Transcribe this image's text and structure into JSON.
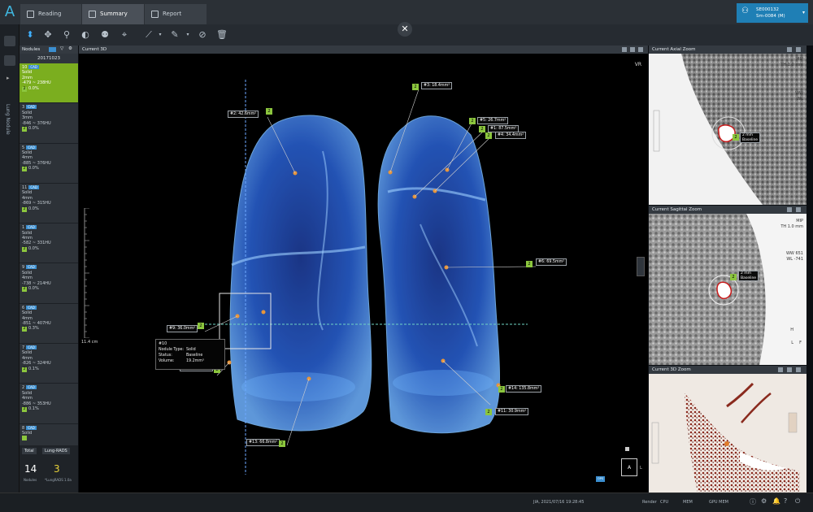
{
  "topbar": {
    "logo": "A",
    "tabs": [
      {
        "label": "Reading"
      },
      {
        "label": "Summary"
      },
      {
        "label": "Report"
      }
    ],
    "patient": {
      "line1": "SE000132",
      "line2": "Sm-0084 (M)",
      "icon": "person-icon",
      "caret": "▾"
    }
  },
  "rail": {
    "label": "Lung Nodule"
  },
  "nodule_panel": {
    "header": "Nodules",
    "cad_tag": "CAD",
    "date": "20171023",
    "items": [
      {
        "num": "10",
        "cad": "CAD",
        "type": "Solid",
        "size": "2mm",
        "hu": "-479 ~ 238HU",
        "pct": "0.0%",
        "badge": "2"
      },
      {
        "num": "3",
        "cad": "CAD",
        "type": "Solid",
        "size": "3mm",
        "hu": "-846 ~ 376HU",
        "pct": "0.0%",
        "badge": "2"
      },
      {
        "num": "5",
        "cad": "CAD",
        "type": "Solid",
        "size": "4mm",
        "hu": "-885 ~ 376HU",
        "pct": "0.0%",
        "badge": "2"
      },
      {
        "num": "11",
        "cad": "CAD",
        "type": "Solid",
        "size": "4mm",
        "hu": "-869 ~ 315HU",
        "pct": "0.0%",
        "badge": "2"
      },
      {
        "num": "1",
        "cad": "CAD",
        "type": "Solid",
        "size": "4mm",
        "hu": "-582 ~ 331HU",
        "pct": "0.0%",
        "badge": "2"
      },
      {
        "num": "9",
        "cad": "CAD",
        "type": "Solid",
        "size": "4mm",
        "hu": "-738 ~ 214HU",
        "pct": "0.0%",
        "badge": "2"
      },
      {
        "num": "6",
        "cad": "CAD",
        "type": "Solid",
        "size": "4mm",
        "hu": "-851 ~ 407HU",
        "pct": "0.3%",
        "badge": "2"
      },
      {
        "num": "7",
        "cad": "CAD",
        "type": "Solid",
        "size": "4mm",
        "hu": "-826 ~ 324HU",
        "pct": "0.1%",
        "badge": "2"
      },
      {
        "num": "2",
        "cad": "CAD",
        "type": "Solid",
        "size": "4mm",
        "hu": "-886 ~ 353HU",
        "pct": "0.1%",
        "badge": "2"
      },
      {
        "num": "8",
        "cad": "CAD",
        "type": "Solid",
        "size": "",
        "hu": "",
        "pct": "",
        "badge": ""
      }
    ],
    "totals": {
      "total_label": "Total",
      "lungrads_label": "Lung-RADS",
      "total_value": "14",
      "total_sub": "Nodules",
      "lungrads_value": "3",
      "lungrads_sub": "*LungRADS 1.0a"
    }
  },
  "view3d": {
    "title": "Current 3D",
    "mode": "VR",
    "scale": "11.4 cm",
    "orientation": "A",
    "orientation_side": "L",
    "corner_tag": "OPS",
    "callouts": [
      {
        "id": "c1",
        "text": "#2: 42.6mm²",
        "badge": "2"
      },
      {
        "id": "c2",
        "text": "#3: 18.4mm²",
        "badge": "2"
      },
      {
        "id": "c3",
        "text": "#5: 26.7mm²",
        "badge": "2"
      },
      {
        "id": "c4",
        "text": "#1: 87.5mm²",
        "badge": "2"
      },
      {
        "id": "c5",
        "text": "#4: 34.4mm²",
        "badge": "2"
      },
      {
        "id": "c6",
        "text": "#6: 69.5mm²",
        "badge": "2"
      },
      {
        "id": "c7",
        "text": "#9: 36.0mm²",
        "badge": "2"
      },
      {
        "id": "c8",
        "text": "#12: 67.2mm²",
        "badge": "2"
      },
      {
        "id": "c9",
        "text": "#14: 135.8mm²",
        "badge": "2"
      },
      {
        "id": "c10",
        "text": "#11: 30.9mm²",
        "badge": "2"
      },
      {
        "id": "c11",
        "text": "#13: 66.8mm²",
        "badge": "2"
      }
    ],
    "info": {
      "id": "#10",
      "type_label": "Nodule Type:",
      "type_value": "Solid",
      "status_label": "Status:",
      "status_value": "Baseline",
      "volume_label": "Volume:",
      "volume_value": "19.2mm³"
    }
  },
  "right": {
    "axial": {
      "title": "Current Axial Zoom",
      "ovl": [
        "MIP",
        "TH 1.0 mm"
      ],
      "ovl2": [
        "WW",
        "WL"
      ],
      "badge": "2",
      "tag1": "2 mm",
      "tag2": "Baseline"
    },
    "sagittal": {
      "title": "Current Sagittal Zoom",
      "ovl": [
        "MIP",
        "TH 1.0 mm"
      ],
      "ovl2": [
        "WW  651",
        "WL  -741"
      ],
      "badge": "2",
      "tag1": "2 mm",
      "tag2": "Baseline",
      "dir1": "H",
      "dir2": "L",
      "dir3": "F"
    },
    "zoom3d": {
      "title": "Current 3D Zoom"
    }
  },
  "status": {
    "user": "JIA, 2021/07/16 19:28:45",
    "render": "Render",
    "cpu": "CPU",
    "mem": "MEM",
    "gpu": "GPU MEM"
  },
  "colors": {
    "accent": "#8cc63e",
    "lung": "#2f6fd6",
    "tab_active": "#4a5058",
    "patient": "#1f7fb5"
  }
}
